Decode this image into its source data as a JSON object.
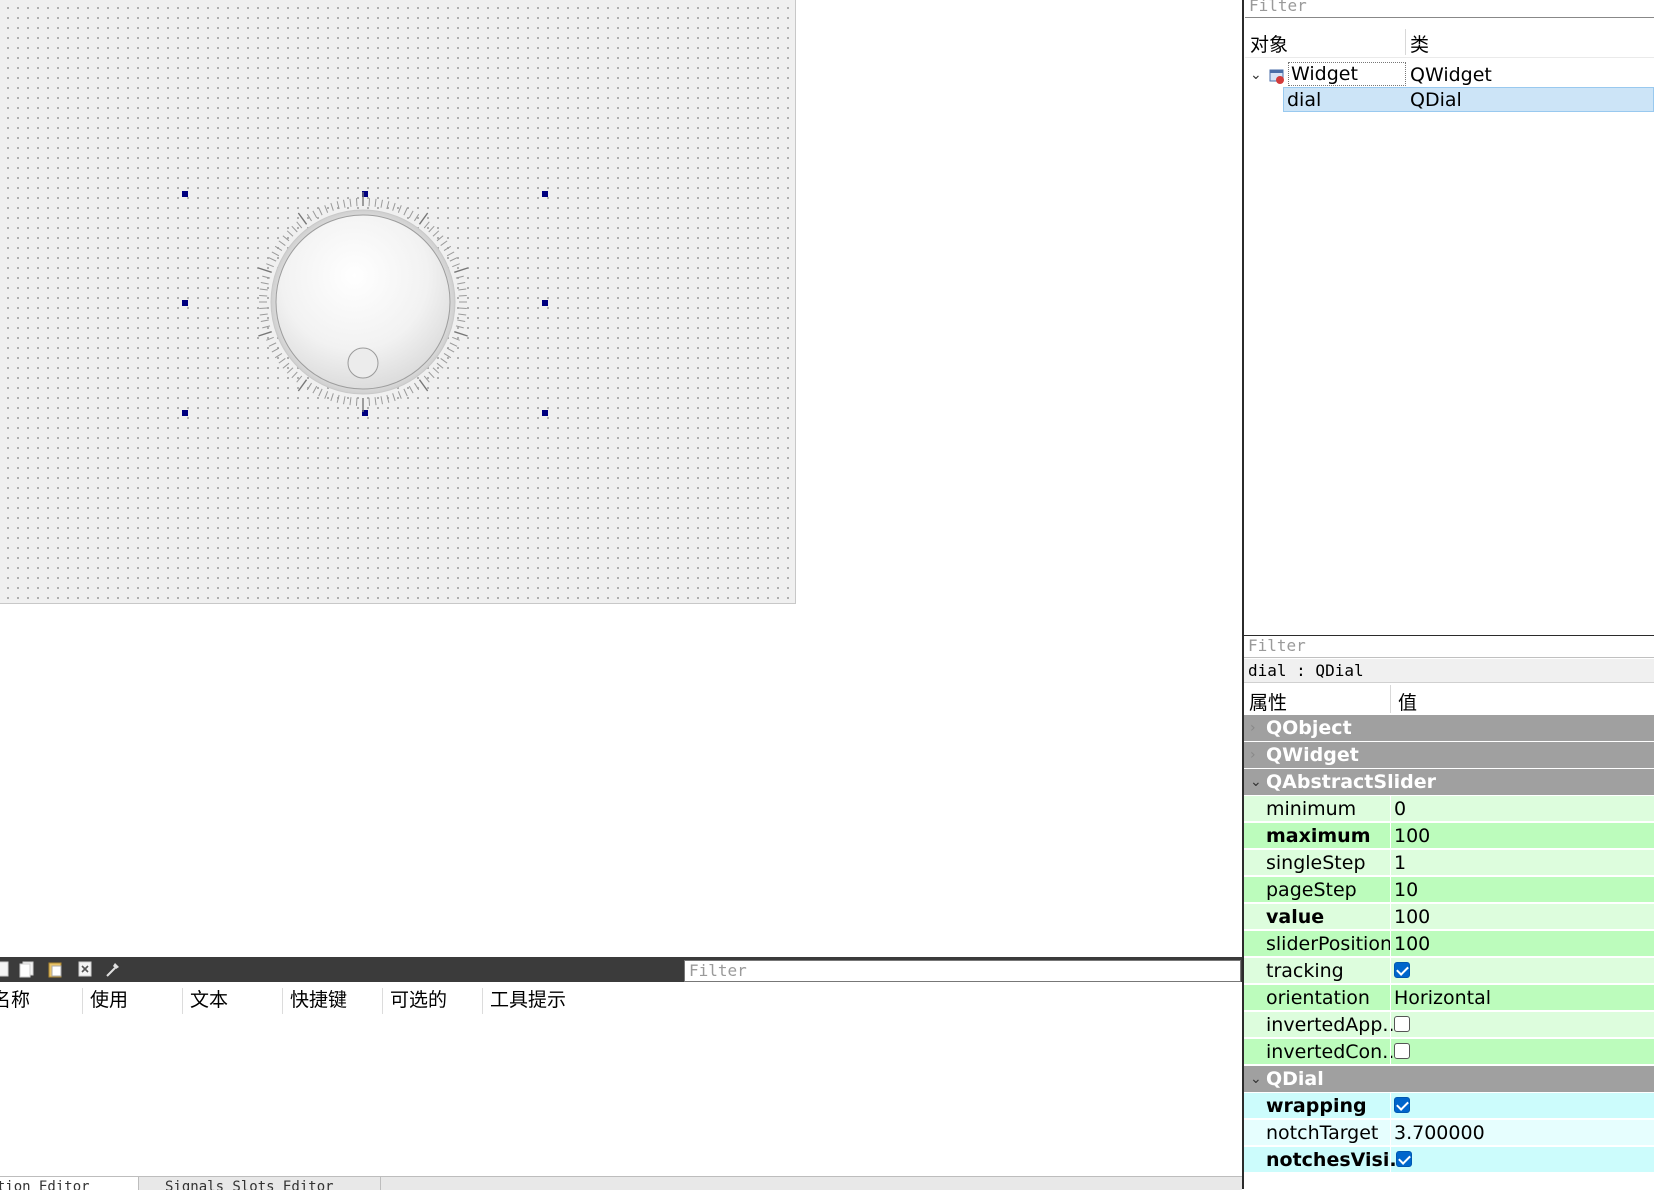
{
  "object_inspector": {
    "filter_placeholder": "Filter",
    "col_object": "对象",
    "col_class": "类",
    "rows": [
      {
        "name": "Widget",
        "class": "QWidget",
        "expanded": true,
        "selected": false
      },
      {
        "name": "dial",
        "class": "QDial",
        "selected": true
      }
    ]
  },
  "property_editor": {
    "filter_placeholder": "Filter",
    "object_label": "dial : QDial",
    "col_property": "属性",
    "col_value": "值",
    "groups": {
      "qobject": "QObject",
      "qwidget": "QWidget",
      "qabstractslider": "QAbstractSlider",
      "qdial": "QDial"
    },
    "props": {
      "minimum": {
        "name": "minimum",
        "value": "0"
      },
      "maximum": {
        "name": "maximum",
        "value": "100"
      },
      "singleStep": {
        "name": "singleStep",
        "value": "1"
      },
      "pageStep": {
        "name": "pageStep",
        "value": "10"
      },
      "value": {
        "name": "value",
        "value": "100"
      },
      "sliderPosition": {
        "name": "sliderPosition",
        "value": "100"
      },
      "tracking": {
        "name": "tracking",
        "checked": true
      },
      "orientation": {
        "name": "orientation",
        "value": "Horizontal"
      },
      "invertedAppearance": {
        "name": "invertedApp...",
        "checked": false
      },
      "invertedControls": {
        "name": "invertedCon...",
        "checked": false
      },
      "wrapping": {
        "name": "wrapping",
        "checked": true
      },
      "notchTarget": {
        "name": "notchTarget",
        "value": "3.700000"
      },
      "notchesVisible": {
        "name": "notchesVisi...",
        "checked": true
      }
    },
    "colors": {
      "group_bg": "#a0a0a0",
      "abstractslider_row_a": "#ddfddd",
      "abstractslider_row_b": "#bcfcbc",
      "dial_row_a": "#ccfcfc",
      "dial_row_b": "#e6fefe",
      "checkbox_on": "#0066cc"
    }
  },
  "action_editor": {
    "filter_placeholder": "Filter",
    "columns": [
      "名称",
      "使用",
      "文本",
      "快捷键",
      "可选的",
      "工具提示"
    ],
    "toolbar_icons": [
      "new-action-icon",
      "copy-icon",
      "paste-icon",
      "delete-icon",
      "configure-icon"
    ]
  },
  "bottom_tabs": [
    "Action Editor",
    "Signals Slots Editor"
  ],
  "canvas": {
    "selected_widget": "dial",
    "widget_type": "QDial"
  }
}
